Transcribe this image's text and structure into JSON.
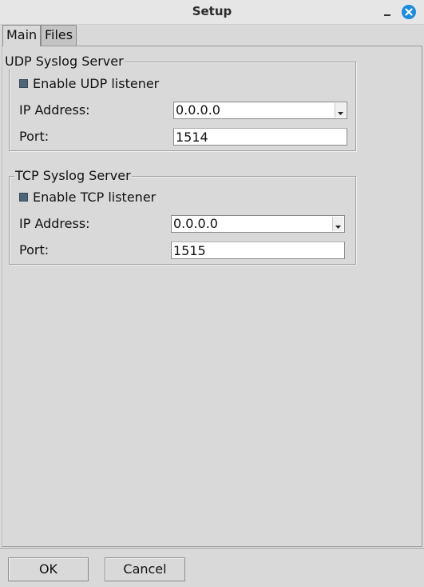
{
  "window": {
    "title": "Setup",
    "close_color": "#1e8bd9"
  },
  "tabs": [
    {
      "label": "Main",
      "selected": true
    },
    {
      "label": "Files",
      "selected": false
    }
  ],
  "udp": {
    "group_title": "UDP Syslog Server",
    "enable_label": "Enable UDP listener",
    "enabled": true,
    "ip_label": "IP Address:",
    "ip_value": "0.0.0.0",
    "port_label": "Port:",
    "port_value": "1514"
  },
  "tcp": {
    "group_title": "TCP Syslog Server",
    "enable_label": "Enable TCP listener",
    "enabled": true,
    "ip_label": "IP Address:",
    "ip_value": "0.0.0.0",
    "port_label": "Port:",
    "port_value": "1515"
  },
  "buttons": {
    "ok_label": "OK",
    "cancel_label": "Cancel"
  },
  "icons": {
    "minimize": "minimize-icon",
    "close": "close-icon",
    "dropdown": "chevron-down-icon",
    "checkbox": "checkbox-icon"
  }
}
